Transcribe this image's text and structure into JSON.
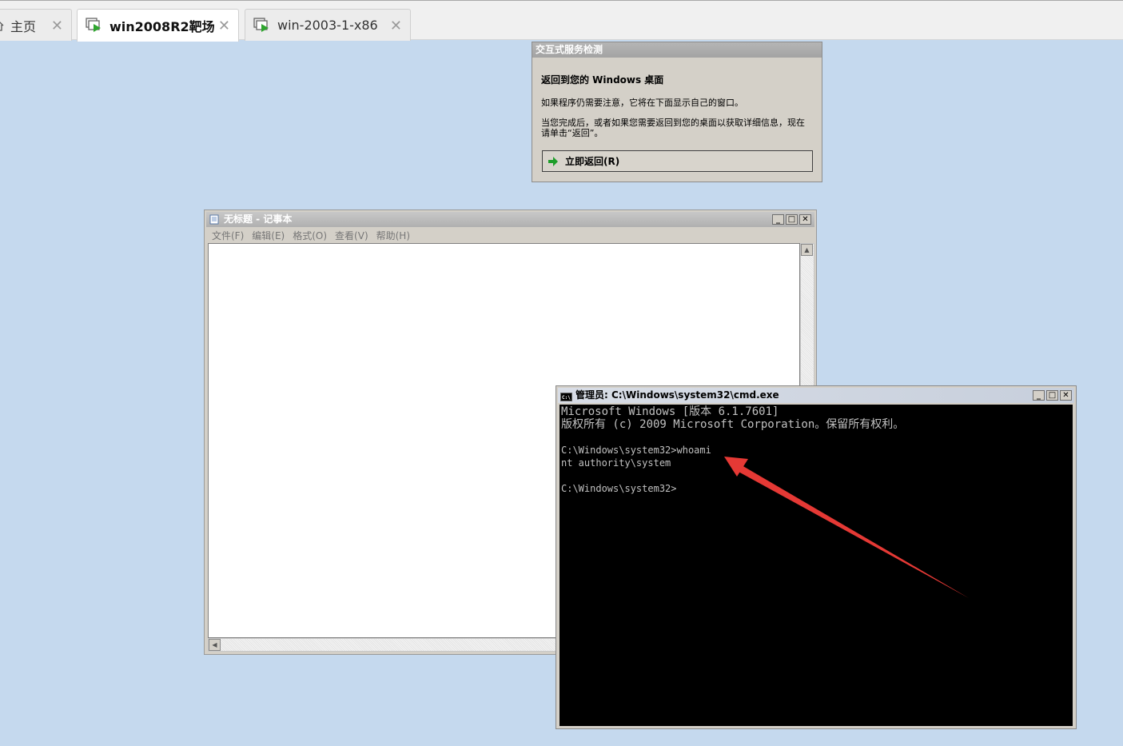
{
  "tabs": [
    {
      "label": "主页",
      "icon": "home-icon",
      "active": false
    },
    {
      "label": "win2008R2靶场",
      "icon": "vm-running-icon",
      "active": true
    },
    {
      "label": "win-2003-1-x86",
      "icon": "vm-running-icon",
      "active": false
    }
  ],
  "tab_close": "✕",
  "service_dialog": {
    "title": "交互式服务检测",
    "heading": "返回到您的 Windows 桌面",
    "text1": "如果程序仍需要注意，它将在下面显示自己的窗口。",
    "text2": "当您完成后，或者如果您需要返回到您的桌面以获取详细信息，现在请单击“返回”。",
    "button": "立即返回(R)"
  },
  "notepad": {
    "title": "无标题 - 记事本",
    "menu": [
      "文件(F)",
      "编辑(E)",
      "格式(O)",
      "查看(V)",
      "帮助(H)"
    ]
  },
  "cmd": {
    "title": "管理员: C:\\Windows\\system32\\cmd.exe",
    "lines": [
      "Microsoft Windows [版本 6.1.7601]",
      "版权所有 (c) 2009 Microsoft Corporation。保留所有权利。",
      "",
      "C:\\Windows\\system32>whoami",
      "nt authority\\system",
      "",
      "C:\\Windows\\system32>"
    ]
  },
  "window_controls": {
    "minimize": "_",
    "maximize": "□",
    "close": "✕"
  },
  "colors": {
    "desktop": "#c5d9ee",
    "annotation_arrow": "#e53935",
    "console_bg": "#000000",
    "console_text": "#c0c0c0"
  }
}
